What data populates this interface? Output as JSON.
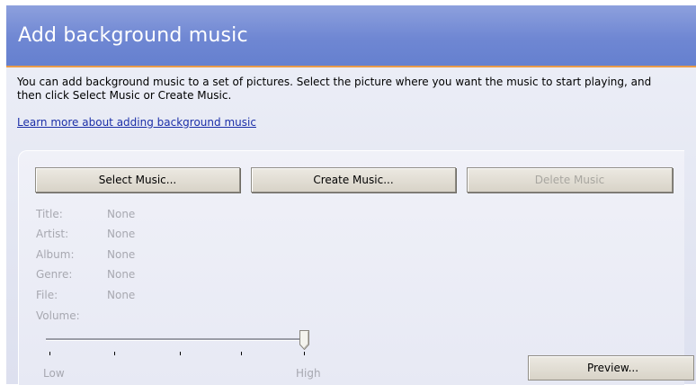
{
  "header": {
    "title": "Add background music"
  },
  "intro": {
    "text": "You can add background music to a set of pictures.  Select the picture where you want the music to start playing, and then click Select Music or Create Music.",
    "link": "Learn more about adding background music"
  },
  "buttons": {
    "select": "Select Music...",
    "create": "Create Music...",
    "delete": "Delete Music",
    "preview": "Preview..."
  },
  "metadata": {
    "title_label": "Title:",
    "title_value": "None",
    "artist_label": "Artist:",
    "artist_value": "None",
    "album_label": "Album:",
    "album_value": "None",
    "genre_label": "Genre:",
    "genre_value": "None",
    "file_label": "File:",
    "file_value": "None",
    "volume_label": "Volume:"
  },
  "volume": {
    "low_label": "Low",
    "high_label": "High",
    "level": 1.0
  },
  "colors": {
    "header": "#6f87d3",
    "header_underline": "#e99b4a",
    "link": "#1c2fa8",
    "disabled_text": "#a7a8b0"
  }
}
